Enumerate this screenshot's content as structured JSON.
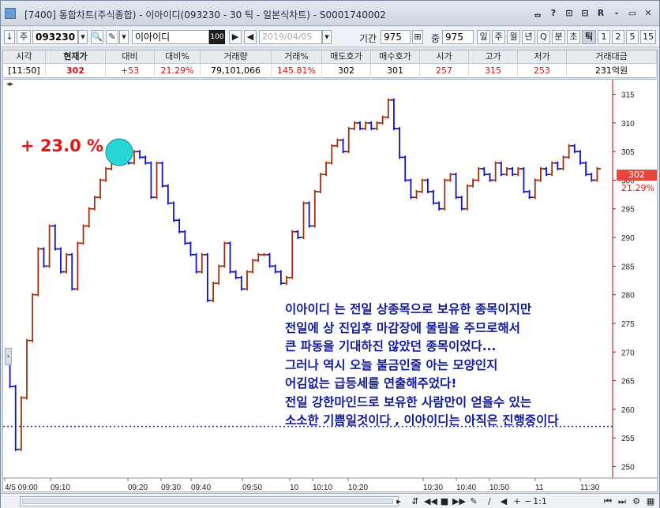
{
  "window": {
    "title": "[7400] 통합차트(주식종합) - 이아이디(093230 - 30 틱 - 일본식차트) - S0001740002",
    "buttons": [
      "ᆷ",
      "?",
      "⊡",
      "⊟",
      "R",
      "-",
      "▭",
      "✕"
    ]
  },
  "toolbar": {
    "down_label": "↓",
    "type_label": "주",
    "code": "093230",
    "name": "이아이디",
    "count_badge": "100",
    "date": "2019/04/05",
    "period_label": "기간",
    "period_value": "975",
    "mid_label": "중",
    "mid_value": "975",
    "intervals": [
      "일",
      "주",
      "월",
      "년",
      "Q",
      "분",
      "초",
      "틱",
      "1",
      "2",
      "5",
      "15"
    ],
    "selected_interval": "틱"
  },
  "quote": {
    "headers": [
      "시각",
      "현재가",
      "대비",
      "대비%",
      "거래량",
      "거래%",
      "매도호가",
      "매수호가",
      "시가",
      "고가",
      "저가",
      "거래대금"
    ],
    "values": [
      "[11:50]",
      "302",
      "+53",
      "21.29%",
      "79,101,066",
      "145.81%",
      "302",
      "301",
      "257",
      "315",
      "253",
      "231억원"
    ]
  },
  "chart": {
    "nav_label": "◂▸",
    "pct_annotation": "+ 23.0 %",
    "price_tag": "302",
    "pct_tag": "21.29%",
    "memo_lines": [
      "이아이디 는 전일 상종목으로 보유한 종목이지만",
      "전일에 상 진입후 마감장에 물림을 주므로해서",
      "큰 파동을 기대하진 않았던 종목이었다...",
      "그러나 역시 오늘 불금인줄 아는 모양인지",
      "어김없는 급등세를 연출해주었다!",
      "전일 강한마인드로 보유한 사람만이 얻을수 있는",
      "소소한 기쁨일것이다 , 이아이디는 아직은 진행중이다"
    ]
  },
  "chart_data": {
    "type": "line",
    "title": "",
    "xlabel": "",
    "ylabel": "",
    "ylim": [
      248,
      317
    ],
    "yticks": [
      250,
      255,
      260,
      265,
      270,
      275,
      280,
      285,
      290,
      295,
      300,
      305,
      310,
      315
    ],
    "xticks": [
      "4/5 09:00",
      "09:10",
      "09:20",
      "09:30",
      "09:40",
      "09:50",
      "10",
      "10:10",
      "10:20",
      "10:30",
      "10:40",
      "10:50",
      "11",
      "11:30"
    ],
    "reference_line": 257,
    "up_color": "#a0300c",
    "down_color": "#1010cc",
    "x": [
      0,
      1,
      2,
      3,
      4,
      5,
      6,
      7,
      8,
      9,
      10,
      11,
      12,
      13,
      14,
      15,
      16,
      17,
      18,
      19,
      20,
      21,
      22,
      23,
      24,
      25,
      26,
      27,
      28,
      29,
      30,
      31,
      32,
      33,
      34,
      35,
      36,
      37,
      38,
      39,
      40,
      41,
      42,
      43,
      44,
      45,
      46,
      47,
      48,
      49,
      50,
      51,
      52,
      53,
      54,
      55,
      56,
      57,
      58,
      59,
      60,
      61,
      62,
      63,
      64,
      65,
      66,
      67,
      68,
      69,
      70,
      71,
      72,
      73,
      74,
      75,
      76,
      77,
      78,
      79,
      80,
      81,
      82,
      83,
      84,
      85,
      86,
      87,
      88,
      89,
      90,
      91,
      92,
      93,
      94,
      95,
      96,
      97,
      98,
      99,
      100,
      101,
      102,
      103,
      104,
      105,
      106,
      107,
      108,
      109,
      110,
      111,
      112,
      113,
      114,
      115,
      116,
      117,
      118,
      119,
      120
    ],
    "values": [
      268,
      264,
      253,
      262,
      272,
      280,
      288,
      285,
      292,
      288,
      284,
      287,
      281,
      289,
      292,
      295,
      297,
      300,
      302,
      303,
      305,
      306,
      303,
      305,
      304,
      303,
      297,
      303,
      299,
      296,
      293,
      291,
      289,
      287,
      284,
      287,
      279,
      282,
      285,
      289,
      284,
      283,
      281,
      284,
      286,
      287,
      287,
      285,
      284,
      282,
      283,
      291,
      290,
      296,
      292,
      298,
      301,
      303,
      306,
      307,
      305,
      309,
      310,
      309,
      310,
      309,
      310,
      311,
      314,
      309,
      304,
      300,
      297,
      298,
      300,
      298,
      296,
      295,
      300,
      301,
      297,
      295,
      299,
      300,
      302,
      301,
      300,
      303,
      301,
      302,
      301,
      302,
      298,
      297,
      300,
      302,
      301,
      303,
      302,
      304,
      306,
      305,
      303,
      301,
      300,
      302
    ]
  }
}
